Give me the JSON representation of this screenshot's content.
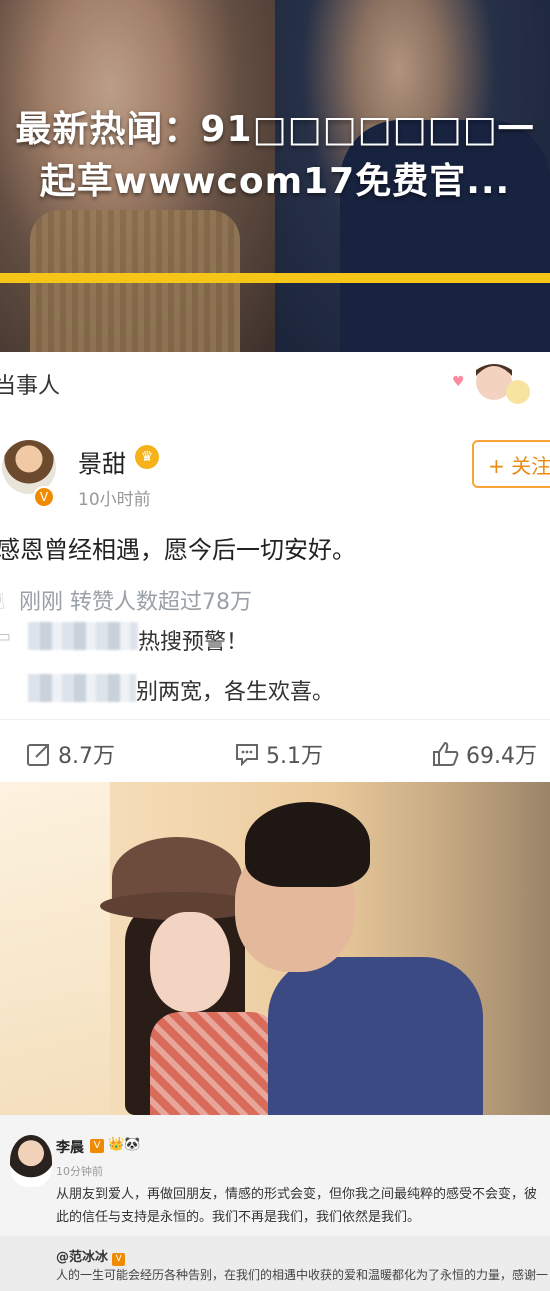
{
  "hero": {
    "headline_line1": "最新热闻：91□□□□□□□一",
    "headline_line2": "起草wwwcom17免费官..."
  },
  "weibo_post": {
    "tab_label": "当事人",
    "username": "景甜",
    "crown_icon": "crown-icon",
    "timestamp": "10小时前",
    "follow_label": "+ 关注",
    "content": "感恩曾经相遇，愿今后一切安好。",
    "stats_line": "刚刚 转赞人数超过78万",
    "comment1": "热搜预警！",
    "comment2": "别两宽，各生欢喜。",
    "actions": {
      "repost_count": "8.7万",
      "comment_count": "5.1万",
      "like_count": "69.4万"
    }
  },
  "bottom_post": {
    "username": "李晨",
    "verified_badge": "V",
    "timestamp": "10分钟前",
    "content": "从朋友到爱人，再做回朋友，情感的形式会变，但你我之间最纯粹的感受不会变，彼此的信任与支持是永恒的。我们不再是我们，我们依然是我们。",
    "repost_author": "@范冰冰",
    "repost_text": "人的一生可能会经历各种告别，在我们的相遇中收获的爱和温暖都化为了永恒的力量，感谢一"
  },
  "colors": {
    "accent_yellow": "#f5c518",
    "follow_orange": "#e98a12",
    "verified_orange": "#f08a00"
  }
}
